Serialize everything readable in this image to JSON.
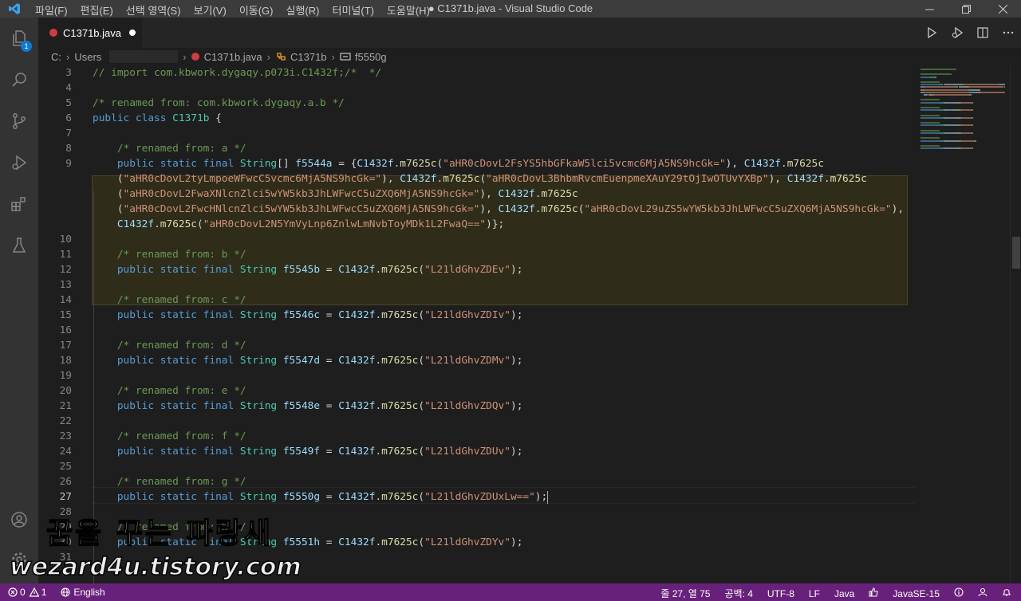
{
  "titlebar": {
    "menu": [
      "파일(F)",
      "편집(E)",
      "선택 영역(S)",
      "보기(V)",
      "이동(G)",
      "실행(R)",
      "터미널(T)",
      "도움말(H)"
    ],
    "window_title": "● C1371b.java - Visual Studio Code"
  },
  "activity": {
    "explorer_badge": "1"
  },
  "tab": {
    "label": "C1371b.java"
  },
  "breadcrumb": {
    "drive": "C:",
    "users": "Users",
    "file": "C1371b.java",
    "class": "C1371b",
    "field": "f5550g"
  },
  "editor": {
    "current_line": "27",
    "lines": [
      {
        "n": "3",
        "t": [
          [
            "c",
            "// import com.kbwork.dygaqy.p073i.C1432f;/*  */"
          ]
        ]
      },
      {
        "n": "4",
        "t": []
      },
      {
        "n": "5",
        "t": [
          [
            "c",
            "/* renamed from: com.kbwork.dygaqy.a.b */"
          ]
        ]
      },
      {
        "n": "6",
        "t": [
          [
            "k",
            "public class "
          ],
          [
            "t",
            "C1371b"
          ],
          [
            "p",
            " {"
          ]
        ]
      },
      {
        "n": "7",
        "t": []
      },
      {
        "n": "8",
        "t": [
          [
            "c",
            "    /* renamed from: a */"
          ]
        ]
      },
      {
        "n": "9",
        "t": [
          [
            "k",
            "    public static final "
          ],
          [
            "t",
            "String"
          ],
          [
            "p",
            "[] "
          ],
          [
            "i",
            "f5544a"
          ],
          [
            "p",
            " = {"
          ],
          [
            "i",
            "C1432f"
          ],
          [
            "p",
            "."
          ],
          [
            "f",
            "m7625c"
          ],
          [
            "p",
            "("
          ],
          [
            "s",
            "\"aHR0cDovL2FsYS5hbGFkaW5lci5vcmc6MjA5NS9hcGk=\""
          ],
          [
            "p",
            "), "
          ],
          [
            "i",
            "C1432f"
          ],
          [
            "p",
            "."
          ],
          [
            "f",
            "m7625c"
          ]
        ]
      },
      {
        "n": "",
        "t": [
          [
            "p",
            "    ("
          ],
          [
            "s",
            "\"aHR0cDovL2tyLmpoeWFwcC5vcmc6MjA5NS9hcGk=\""
          ],
          [
            "p",
            "), "
          ],
          [
            "i",
            "C1432f"
          ],
          [
            "p",
            "."
          ],
          [
            "f",
            "m7625c"
          ],
          [
            "p",
            "("
          ],
          [
            "s",
            "\"aHR0cDovL3BhbmRvcmEuenpmeXAuY29tOjIwOTUvYXBp\""
          ],
          [
            "p",
            "), "
          ],
          [
            "i",
            "C1432f"
          ],
          [
            "p",
            "."
          ],
          [
            "f",
            "m7625c"
          ]
        ]
      },
      {
        "n": "",
        "t": [
          [
            "p",
            "    ("
          ],
          [
            "s",
            "\"aHR0cDovL2FwaXNlcnZlci5wYW5kb3JhLWFwcC5uZXQ6MjA5NS9hcGk=\""
          ],
          [
            "p",
            "), "
          ],
          [
            "i",
            "C1432f"
          ],
          [
            "p",
            "."
          ],
          [
            "f",
            "m7625c"
          ]
        ]
      },
      {
        "n": "",
        "t": [
          [
            "p",
            "    ("
          ],
          [
            "s",
            "\"aHR0cDovL2FwcHNlcnZlci5wYW5kb3JhLWFwcC5uZXQ6MjA5NS9hcGk=\""
          ],
          [
            "p",
            "), "
          ],
          [
            "i",
            "C1432f"
          ],
          [
            "p",
            "."
          ],
          [
            "f",
            "m7625c"
          ],
          [
            "p",
            "("
          ],
          [
            "s",
            "\"aHR0cDovL29uZS5wYW5kb3JhLWFwcC5uZXQ6MjA5NS9hcGk=\""
          ],
          [
            "p",
            "),"
          ]
        ]
      },
      {
        "n": "",
        "t": [
          [
            "p",
            "    "
          ],
          [
            "i",
            "C1432f"
          ],
          [
            "p",
            "."
          ],
          [
            "f",
            "m7625c"
          ],
          [
            "p",
            "("
          ],
          [
            "s",
            "\"aHR0cDovL2N5YmVyLnp6ZnlwLmNvbToyMDk1L2FwaQ==\""
          ],
          [
            "p",
            ")};"
          ]
        ]
      },
      {
        "n": "10",
        "t": []
      },
      {
        "n": "11",
        "t": [
          [
            "c",
            "    /* renamed from: b */"
          ]
        ]
      },
      {
        "n": "12",
        "t": [
          [
            "k",
            "    public static final "
          ],
          [
            "t",
            "String "
          ],
          [
            "i",
            "f5545b"
          ],
          [
            "p",
            " = "
          ],
          [
            "i",
            "C1432f"
          ],
          [
            "p",
            "."
          ],
          [
            "f",
            "m7625c"
          ],
          [
            "p",
            "("
          ],
          [
            "s",
            "\"L21ldGhvZDEv\""
          ],
          [
            "p",
            ");"
          ]
        ]
      },
      {
        "n": "13",
        "t": []
      },
      {
        "n": "14",
        "t": [
          [
            "c",
            "    /* renamed from: c */"
          ]
        ]
      },
      {
        "n": "15",
        "t": [
          [
            "k",
            "    public static final "
          ],
          [
            "t",
            "String "
          ],
          [
            "i",
            "f5546c"
          ],
          [
            "p",
            " = "
          ],
          [
            "i",
            "C1432f"
          ],
          [
            "p",
            "."
          ],
          [
            "f",
            "m7625c"
          ],
          [
            "p",
            "("
          ],
          [
            "s",
            "\"L21ldGhvZDIv\""
          ],
          [
            "p",
            ");"
          ]
        ]
      },
      {
        "n": "16",
        "t": []
      },
      {
        "n": "17",
        "t": [
          [
            "c",
            "    /* renamed from: d */"
          ]
        ]
      },
      {
        "n": "18",
        "t": [
          [
            "k",
            "    public static final "
          ],
          [
            "t",
            "String "
          ],
          [
            "i",
            "f5547d"
          ],
          [
            "p",
            " = "
          ],
          [
            "i",
            "C1432f"
          ],
          [
            "p",
            "."
          ],
          [
            "f",
            "m7625c"
          ],
          [
            "p",
            "("
          ],
          [
            "s",
            "\"L21ldGhvZDMv\""
          ],
          [
            "p",
            ");"
          ]
        ]
      },
      {
        "n": "19",
        "t": []
      },
      {
        "n": "20",
        "t": [
          [
            "c",
            "    /* renamed from: e */"
          ]
        ]
      },
      {
        "n": "21",
        "t": [
          [
            "k",
            "    public static final "
          ],
          [
            "t",
            "String "
          ],
          [
            "i",
            "f5548e"
          ],
          [
            "p",
            " = "
          ],
          [
            "i",
            "C1432f"
          ],
          [
            "p",
            "."
          ],
          [
            "f",
            "m7625c"
          ],
          [
            "p",
            "("
          ],
          [
            "s",
            "\"L21ldGhvZDQv\""
          ],
          [
            "p",
            ");"
          ]
        ]
      },
      {
        "n": "22",
        "t": []
      },
      {
        "n": "23",
        "t": [
          [
            "c",
            "    /* renamed from: f */"
          ]
        ]
      },
      {
        "n": "24",
        "t": [
          [
            "k",
            "    public static final "
          ],
          [
            "t",
            "String "
          ],
          [
            "i",
            "f5549f"
          ],
          [
            "p",
            " = "
          ],
          [
            "i",
            "C1432f"
          ],
          [
            "p",
            "."
          ],
          [
            "f",
            "m7625c"
          ],
          [
            "p",
            "("
          ],
          [
            "s",
            "\"L21ldGhvZDUv\""
          ],
          [
            "p",
            ");"
          ]
        ]
      },
      {
        "n": "25",
        "t": []
      },
      {
        "n": "26",
        "t": [
          [
            "c",
            "    /* renamed from: g */"
          ]
        ]
      },
      {
        "n": "27",
        "t": [
          [
            "k",
            "    public static final "
          ],
          [
            "t",
            "String "
          ],
          [
            "i",
            "f5550g"
          ],
          [
            "p",
            " = "
          ],
          [
            "i",
            "C1432f"
          ],
          [
            "p",
            "."
          ],
          [
            "f",
            "m7625c"
          ],
          [
            "p",
            "("
          ],
          [
            "s",
            "\"L21ldGhvZDUxLw==\""
          ],
          [
            "p",
            ");"
          ]
        ]
      },
      {
        "n": "28",
        "t": []
      },
      {
        "n": "29",
        "t": [
          [
            "c",
            "    /* renamed from: h */"
          ]
        ]
      },
      {
        "n": "30",
        "t": [
          [
            "k",
            "    public static final "
          ],
          [
            "t",
            "String "
          ],
          [
            "i",
            "f5551h"
          ],
          [
            "p",
            " = "
          ],
          [
            "i",
            "C1432f"
          ],
          [
            "p",
            "."
          ],
          [
            "f",
            "m7625c"
          ],
          [
            "p",
            "("
          ],
          [
            "s",
            "\"L21ldGhvZDYv\""
          ],
          [
            "p",
            ");"
          ]
        ]
      },
      {
        "n": "31",
        "t": []
      }
    ]
  },
  "statusbar": {
    "errors": "0",
    "warnings": "1",
    "language_switch": "English",
    "position": "줄 27, 열 75",
    "spaces": "공백: 4",
    "encoding": "UTF-8",
    "eol": "LF",
    "language": "Java",
    "runtime": "JavaSE-15"
  },
  "watermark": {
    "korean": "꿈을 꾸는 파랑새",
    "site": "wezard4u.tistory.com"
  },
  "colors": {
    "statusbar": "#68217a",
    "activity": "#333333",
    "editor": "#1e1e1e"
  }
}
